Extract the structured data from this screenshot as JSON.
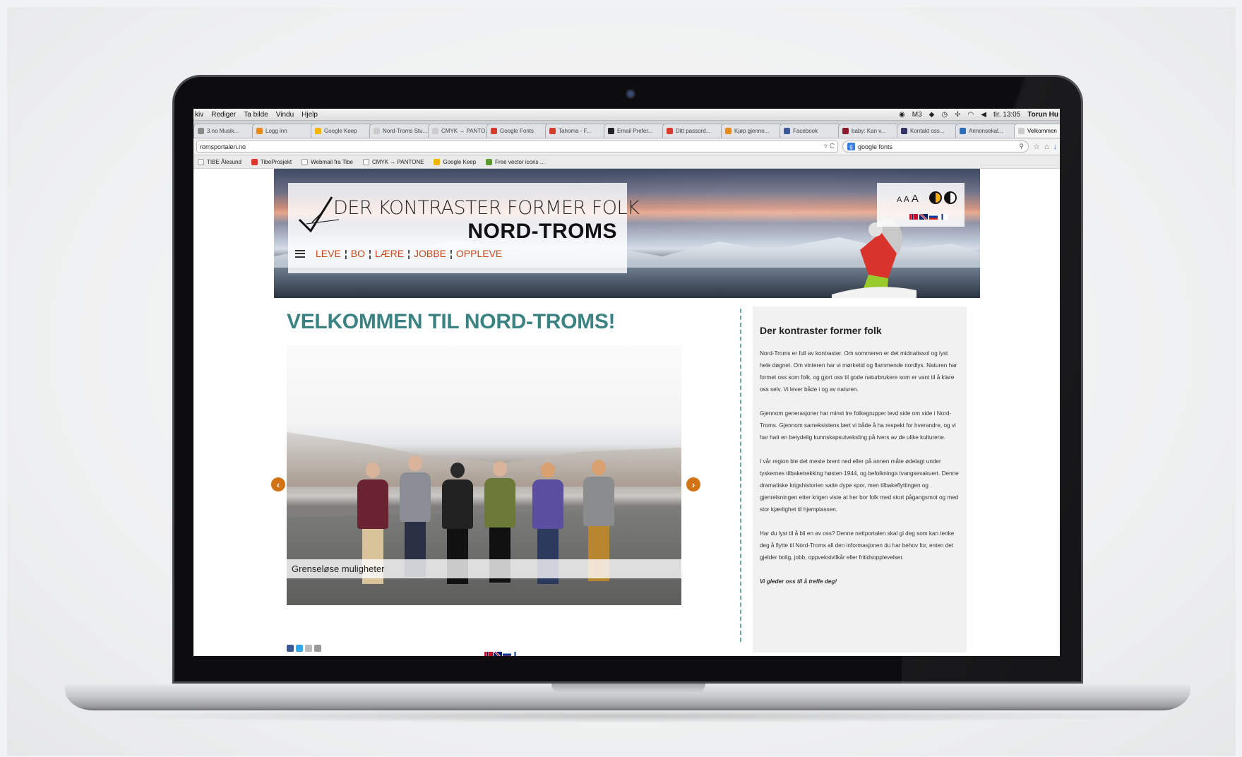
{
  "menubar": {
    "items": [
      "kiv",
      "Rediger",
      "Ta bilde",
      "Vindu",
      "Hjelp"
    ],
    "status": {
      "clock": "tir. 13:05",
      "user": "Torun Hu"
    }
  },
  "tabs": [
    {
      "label": "3.no Musik...",
      "color": "#8a8a8a"
    },
    {
      "label": "Logg inn",
      "color": "#e88a1a"
    },
    {
      "label": "Google Keep",
      "color": "#f5b400"
    },
    {
      "label": "Nord-Troms Stu...",
      "color": "#cccccc"
    },
    {
      "label": "CMYK → PANTO...",
      "color": "#cccccc"
    },
    {
      "label": "Google Fonts",
      "color": "#d83b2b"
    },
    {
      "label": "Tahoma - F...",
      "color": "#d83b2b"
    },
    {
      "label": "Email Prefer...",
      "color": "#222222"
    },
    {
      "label": "Ditt passord...",
      "color": "#d83b2b"
    },
    {
      "label": "Kjøp gjenno...",
      "color": "#e88a1a"
    },
    {
      "label": "Facebook",
      "color": "#3b5998"
    },
    {
      "label": "baby: Kan v...",
      "color": "#8b1a2b"
    },
    {
      "label": "Kontakt oss...",
      "color": "#333366"
    },
    {
      "label": "Annonsekal...",
      "color": "#2a6ebb"
    },
    {
      "label": "Velkommen",
      "color": "#cccccc"
    }
  ],
  "addressbar": {
    "url": "romsportalen.no",
    "search_query": "google fonts"
  },
  "bookmarks": [
    "TIBE Ålesund",
    "TibeProsjekt",
    "Webmail fra Tibe",
    "CMYK → PANTONE",
    "Google Keep",
    "Free vector icons ..."
  ],
  "site": {
    "tagline": "DER KONTRASTER FORMER FOLK",
    "brand": "NORD-TROMS",
    "nav": [
      "LEVE",
      "BO",
      "LÆRE",
      "JOBBE",
      "OPPLEVE"
    ],
    "font_sizes": [
      "A",
      "A",
      "A"
    ],
    "title": "VELKOMMEN TIL NORD-TROMS!",
    "slide_caption": "Grenseløse muligheter",
    "accent": "#3b8282",
    "nav_color": "#c8481a",
    "sidebar": {
      "heading": "Der kontraster former folk",
      "paragraphs": [
        "Nord-Troms er full av kontraster. Om sommeren er det midnattssol og lyst hele døgnet. Om vinteren har vi mørketid og flammende nordlys. Naturen har formet oss som folk, og gjort oss til gode naturbrukere som er vant til å klare oss selv. Vi lever både i og av naturen.",
        "Gjennom generasjoner har minst tre folkegrupper levd side om side i Nord- Troms. Gjennom sameksistens lært vi både å ha respekt for hverandre, og vi har hatt en betydelig kunnskapsutveksling på tvers av de ulike kulturene.",
        "I vår region ble det meste brent ned eller på annen måte ødelagt under tyskernes tilbaketrekking høsten 1944, og befolkninga tvangsevakuert. Denne dramatiske krigshistorien satte dype spor, men tilbakeflyttingen og gjenreisningen etter krigen viste at her bor folk med stort pågangsmot og med stor kjærlighet til hjemplassen.",
        "Har du lyst til å bli en av oss? Denne nettportalen skal gi deg som kan tenke deg å flytte til Nord-Troms all den informasjonen du har behov for, enten det gjelder bolig, jobb, oppvekstvilkår eller fritidsopplevelser."
      ],
      "closing": "Vi gleder oss til å treffe deg!"
    }
  }
}
